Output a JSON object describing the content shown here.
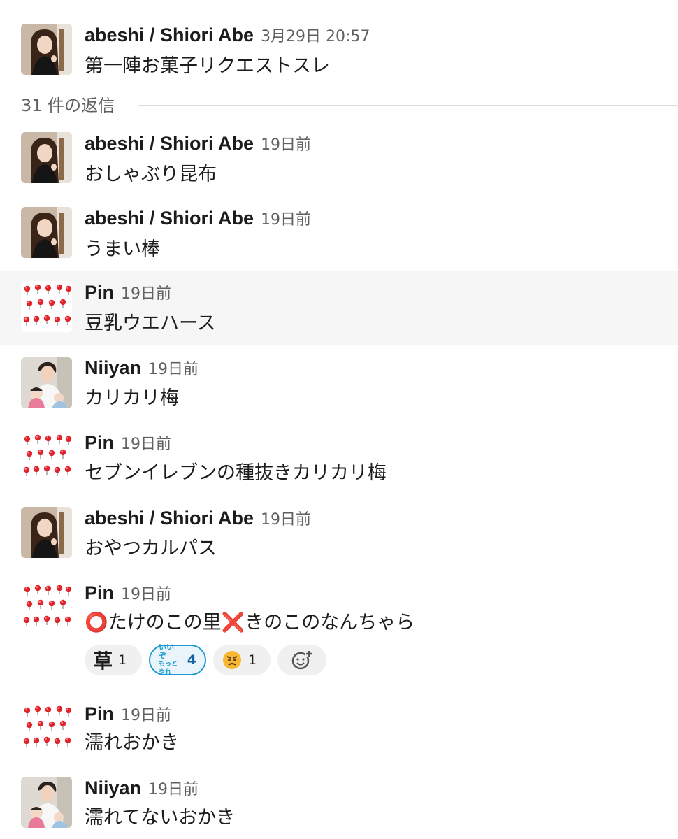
{
  "parent": {
    "author": "abeshi / Shiori Abe",
    "timestamp": "3月29日 20:57",
    "text": "第一陣お菓子リクエストスレ"
  },
  "replies_label": "31 件の返信",
  "messages": [
    {
      "author": "abeshi / Shiori Abe",
      "time": "19日前",
      "text": "おしゃぶり昆布",
      "avatar": "shiori-avatar"
    },
    {
      "author": "abeshi / Shiori Abe",
      "time": "19日前",
      "text": "うまい棒",
      "avatar": "shiori-avatar"
    },
    {
      "author": "Pin",
      "time": "19日前",
      "text": "豆乳ウエハース",
      "avatar": "pushpin-avatar",
      "highlighted": true
    },
    {
      "author": "Niiyan",
      "time": "19日前",
      "text": "カリカリ梅",
      "avatar": "niiyan-avatar"
    },
    {
      "author": "Pin",
      "time": "19日前",
      "text": "セブンイレブンの種抜きカリカリ梅",
      "avatar": "pushpin-avatar"
    },
    {
      "author": "abeshi / Shiori Abe",
      "time": "19日前",
      "text": "おやつカルパス",
      "avatar": "shiori-avatar"
    },
    {
      "author": "Pin",
      "time": "19日前",
      "avatar": "pushpin-avatar",
      "text_parts": {
        "circle": "⭕",
        "middle": "たけのこの里",
        "cross": "❌",
        "end": "きのこのなんちゃら"
      },
      "reactions": [
        {
          "emoji": "草",
          "count": "1",
          "icon": "kusa-emoji"
        },
        {
          "emoji": "いいぞ もっとやれ",
          "emoji_line1": "いいぞ",
          "emoji_line2": "もっとやれ",
          "count": "4",
          "icon": "iizo-motto-yare-emoji",
          "active": true
        },
        {
          "emoji": "😠",
          "count": "1",
          "icon": "angry-face-emoji"
        }
      ],
      "add_reaction_icon": "add-reaction-icon"
    },
    {
      "author": "Pin",
      "time": "19日前",
      "text": "濡れおかき",
      "avatar": "pushpin-avatar"
    },
    {
      "author": "Niiyan",
      "time": "19日前",
      "text": "濡れてないおかき",
      "avatar": "niiyan-avatar"
    }
  ],
  "colors": {
    "accent": "#1d9bd1",
    "accent_text": "#1264a3",
    "pin_red": "#e0242c"
  }
}
